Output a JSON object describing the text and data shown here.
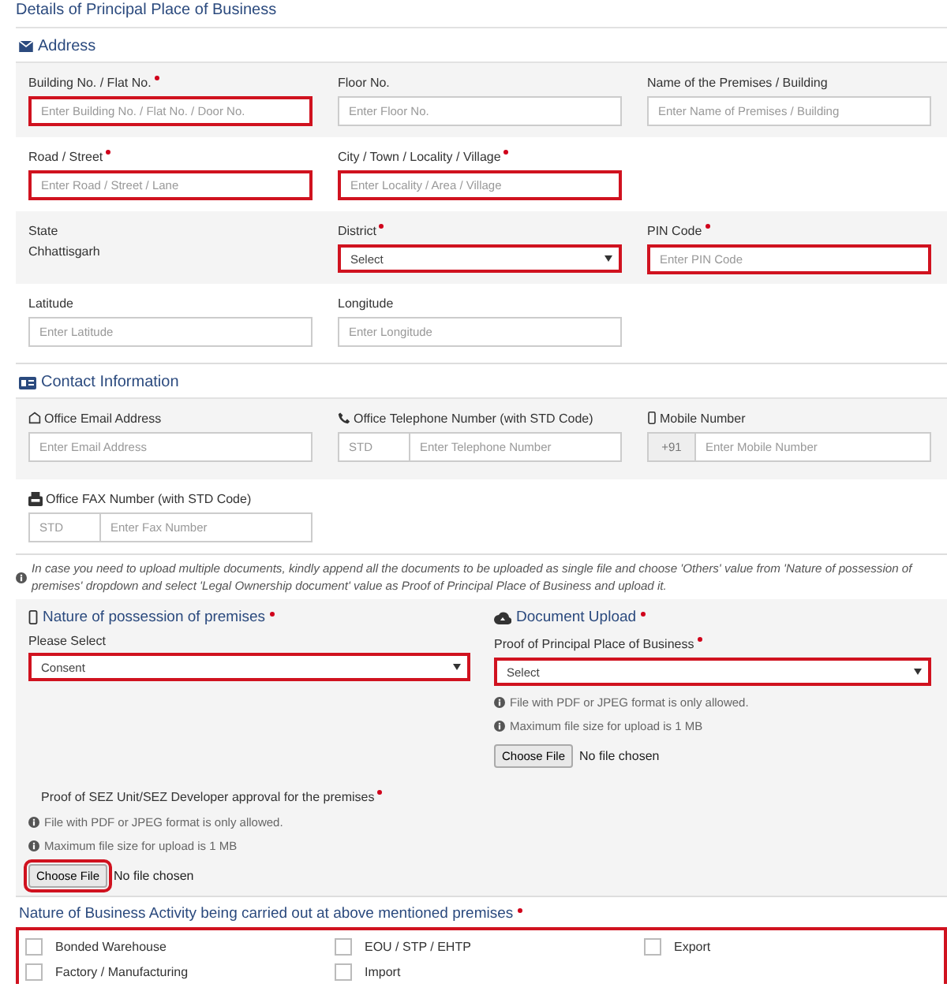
{
  "title": "Details of Principal Place of Business",
  "address": {
    "heading": "Address",
    "rows": [
      {
        "fields": [
          {
            "kind": "input",
            "label": "Building No. / Flat No.",
            "required": true,
            "placeholder": "Enter Building No. / Flat No. / Door No.",
            "highlighted": true
          },
          {
            "kind": "input",
            "label": "Floor No.",
            "required": false,
            "placeholder": "Enter Floor No.",
            "highlighted": false
          },
          {
            "kind": "input",
            "label": "Name of the Premises / Building",
            "required": false,
            "placeholder": "Enter Name of Premises / Building",
            "highlighted": false
          }
        ]
      },
      {
        "fields": [
          {
            "kind": "input",
            "label": "Road / Street",
            "required": true,
            "placeholder": "Enter Road / Street / Lane",
            "highlighted": true
          },
          {
            "kind": "input",
            "label": "City / Town / Locality / Village",
            "required": true,
            "placeholder": "Enter Locality / Area / Village",
            "highlighted": true
          }
        ]
      },
      {
        "fields": [
          {
            "kind": "static",
            "label": "State",
            "required": false,
            "value": "Chhattisgarh"
          },
          {
            "kind": "select",
            "label": "District",
            "required": true,
            "value": "Select",
            "highlighted": true
          },
          {
            "kind": "input",
            "label": "PIN Code",
            "required": true,
            "placeholder": "Enter PIN Code",
            "highlighted": true
          }
        ]
      },
      {
        "fields": [
          {
            "kind": "input",
            "label": "Latitude",
            "required": false,
            "placeholder": "Enter Latitude",
            "highlighted": false
          },
          {
            "kind": "input",
            "label": "Longitude",
            "required": false,
            "placeholder": "Enter Longitude",
            "highlighted": false
          }
        ]
      }
    ]
  },
  "contact": {
    "heading": "Contact Information",
    "rows": [
      {
        "fields": [
          {
            "kind": "input",
            "label": "Office Email Address",
            "required": false,
            "placeholder": "Enter Email Address",
            "highlighted": false
          },
          {
            "kind": "std",
            "label": "Office Telephone Number (with STD Code)",
            "required": false,
            "prefix_placeholder": "STD",
            "placeholder": "Enter Telephone Number",
            "highlighted": false
          },
          {
            "kind": "addon",
            "label": "Mobile Number",
            "required": false,
            "prefix": "+91",
            "placeholder": "Enter Mobile Number",
            "highlighted": false
          }
        ]
      },
      {
        "fields": [
          {
            "kind": "std",
            "label": "Office FAX Number (with STD Code)",
            "required": false,
            "prefix_placeholder": "STD",
            "placeholder": "Enter Fax Number",
            "highlighted": false
          }
        ]
      }
    ]
  },
  "notice": "In case you need to upload multiple documents, kindly append all the documents to be uploaded as single file and choose 'Others' value from 'Nature of possession of premises' dropdown and select 'Legal Ownership document' value as Proof of Principal Place of Business and upload it.",
  "possession": {
    "heading": "Nature of possession of premises",
    "required": true,
    "label": "Please Select",
    "value": "Consent",
    "highlighted": true
  },
  "upload": {
    "heading": "Document Upload",
    "required": true,
    "label": "Proof of Principal Place of Business",
    "label_required": true,
    "value": "Select",
    "highlighted": true,
    "hints": [
      "File with PDF or JPEG format is only allowed.",
      "Maximum file size for upload is 1 MB"
    ],
    "button": "Choose File",
    "file_status": "No file chosen",
    "button_highlighted": false
  },
  "sez": {
    "label": "Proof of SEZ Unit/SEZ Developer approval for the premises",
    "required": true,
    "hints": [
      "File with PDF or JPEG format is only allowed.",
      "Maximum file size for upload is 1 MB"
    ],
    "button": "Choose File",
    "file_status": "No file chosen",
    "button_highlighted": true
  },
  "activities": {
    "heading": "Nature of Business Activity being carried out at above mentioned premises",
    "required": true,
    "highlighted": true,
    "items": [
      {
        "label": "Bonded Warehouse",
        "checked": false
      },
      {
        "label": "EOU / STP / EHTP",
        "checked": false
      },
      {
        "label": "Export",
        "checked": false
      },
      {
        "label": "Factory / Manufacturing",
        "checked": false
      },
      {
        "label": "Import",
        "checked": false
      }
    ]
  }
}
